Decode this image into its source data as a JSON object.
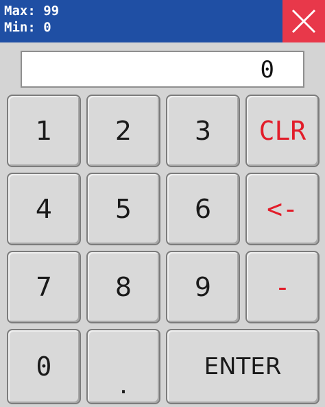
{
  "header": {
    "max_label": "Max: 99",
    "min_label": "Min: 0",
    "close_icon": "close-icon"
  },
  "display": {
    "value": "0"
  },
  "keypad": {
    "k1": "1",
    "k2": "2",
    "k3": "3",
    "clr": "CLR",
    "k4": "4",
    "k5": "5",
    "k6": "6",
    "backspace": "<-",
    "k7": "7",
    "k8": "8",
    "k9": "9",
    "minus": "-",
    "k0": "0",
    "dot": ".",
    "enter": "ENTER"
  },
  "colors": {
    "titlebar": "#1f4fa4",
    "close": "#e8384a",
    "accent_red": "#e21d2a"
  }
}
